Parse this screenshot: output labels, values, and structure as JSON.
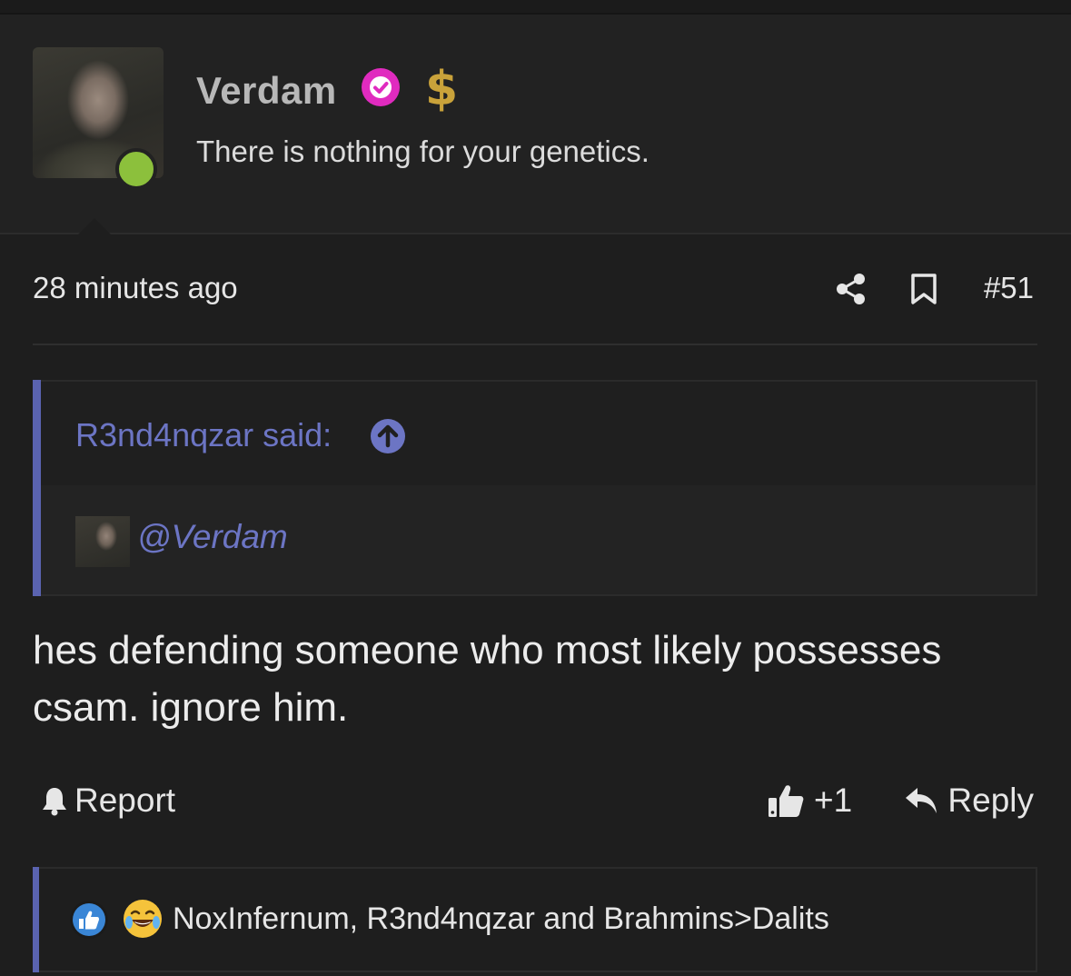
{
  "user": {
    "name": "Verdam",
    "title": "There is nothing for your genetics.",
    "badge_symbol": "$",
    "online": true
  },
  "post": {
    "time": "28 minutes ago",
    "number": "#51",
    "quote": {
      "author_line": "R3nd4nqzar said:",
      "mention": "@Verdam"
    },
    "message": "hes defending someone who most likely possesses csam. ignore him."
  },
  "actions": {
    "report_label": "Report",
    "like_count": "+1",
    "reply_label": "Reply"
  },
  "reactions": {
    "names": "NoxInfernum, R3nd4nqzar and Brahmins>Dalits",
    "types": [
      "like-icon",
      "laugh-icon"
    ]
  },
  "colors": {
    "accent": "#6c75c4",
    "verified": "#e02bbf",
    "online": "#8cc03c",
    "gold": "#c9a23a"
  }
}
